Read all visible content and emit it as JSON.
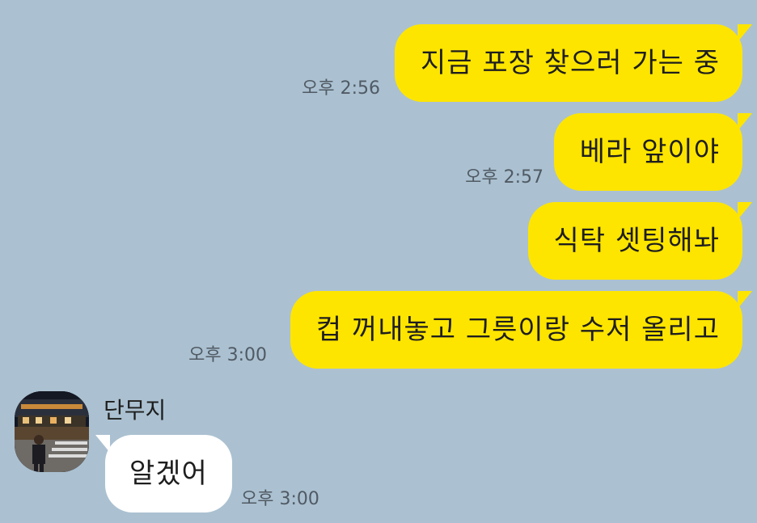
{
  "messages": [
    {
      "text": "지금 포장 찾으러 가는 중",
      "time": "오후 2:56"
    },
    {
      "text": "베라 앞이야",
      "time": "오후 2:57"
    },
    {
      "text": "식탁 셋팅해놔",
      "time": ""
    },
    {
      "text": "컵 꺼내놓고 그릇이랑 수저 올리고",
      "time": "오후 3:00"
    }
  ],
  "incoming": {
    "sender": "단무지",
    "text": "알겠어",
    "time": "오후 3:00"
  },
  "colors": {
    "background": "#abc1d1",
    "my_bubble": "#fee500",
    "their_bubble": "#ffffff"
  }
}
